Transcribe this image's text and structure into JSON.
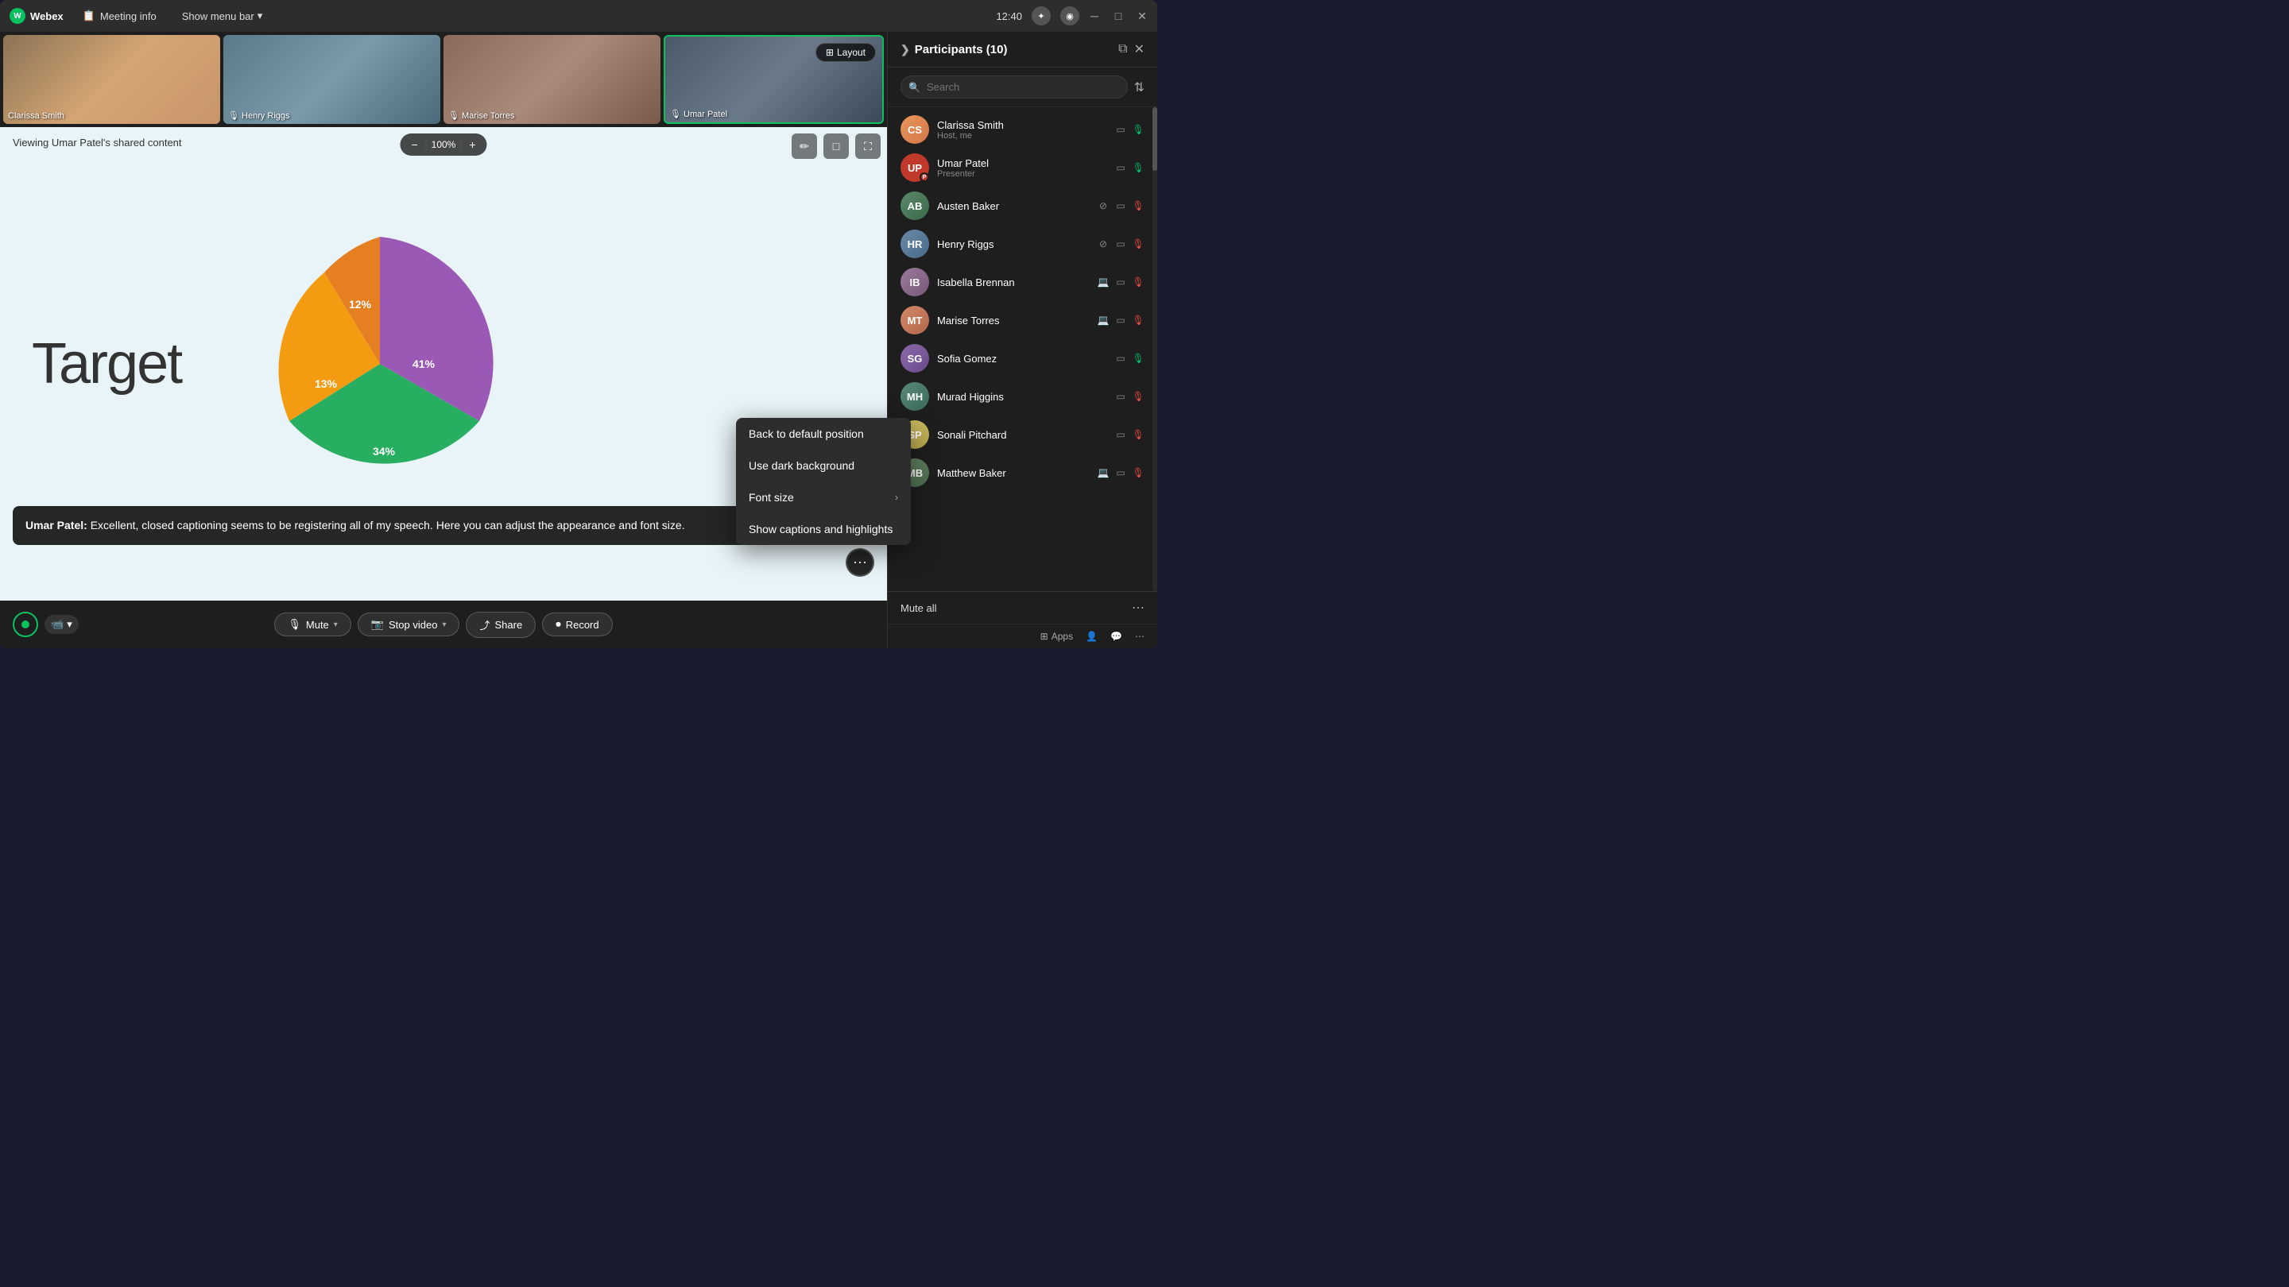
{
  "titlebar": {
    "app_name": "Webex",
    "meeting_info_label": "Meeting info",
    "show_menu_label": "Show menu bar",
    "time": "12:40"
  },
  "thumbnails": [
    {
      "name": "Clarissa Smith",
      "style": "thumb-clarissa",
      "has_mic": false
    },
    {
      "name": "Henry Riggs",
      "style": "thumb-henry",
      "has_mic": true
    },
    {
      "name": "Marise Torres",
      "style": "thumb-marise",
      "has_mic": true
    },
    {
      "name": "Umar Patel",
      "style": "thumb-umar",
      "active": true,
      "has_mic": true
    }
  ],
  "layout_btn": "Layout",
  "shared_content": {
    "viewing_label": "Viewing Umar Patel's shared content",
    "zoom": "100%",
    "chart_title": "Target",
    "pie_data": [
      {
        "label": "41%",
        "color": "#9b59b6",
        "angle_start": 0,
        "angle_end": 147.6
      },
      {
        "label": "34%",
        "color": "#27ae60",
        "angle_start": 147.6,
        "angle_end": 270
      },
      {
        "label": "13%",
        "color": "#f39c12",
        "angle_start": 270,
        "angle_end": 316.8
      },
      {
        "label": "12%",
        "color": "#e67e22",
        "angle_start": 316.8,
        "angle_end": 360
      }
    ]
  },
  "caption": {
    "speaker": "Umar Patel",
    "text": "Excellent, closed captioning seems to be registering all of my speech. Here you can adjust the appearance and font size."
  },
  "toolbar": {
    "mute_label": "Mute",
    "stop_video_label": "Stop video",
    "share_label": "Share",
    "record_label": "Record"
  },
  "participants_panel": {
    "title": "Participants",
    "count": 10,
    "search_placeholder": "Search",
    "mute_all_label": "Mute all",
    "participants": [
      {
        "name": "Clarissa Smith",
        "role": "Host, me",
        "avatar": "CS",
        "av_class": "av-clarissa",
        "video": true,
        "mic": true,
        "mic_red": false
      },
      {
        "name": "Umar Patel",
        "role": "Presenter",
        "avatar": "UP",
        "av_class": "av-umar",
        "video": true,
        "mic": true,
        "mic_red": false
      },
      {
        "name": "Austen Baker",
        "role": "",
        "avatar": "AB",
        "av_class": "av-austen",
        "video": true,
        "mic": false,
        "mic_red": true
      },
      {
        "name": "Henry Riggs",
        "role": "",
        "avatar": "HR",
        "av_class": "av-henry",
        "video": true,
        "mic": false,
        "mic_red": true
      },
      {
        "name": "Isabella Brennan",
        "role": "",
        "avatar": "IB",
        "av_class": "av-isabella",
        "video": true,
        "mic": false,
        "mic_red": true
      },
      {
        "name": "Marise Torres",
        "role": "",
        "avatar": "MT",
        "av_class": "av-marise",
        "video": true,
        "mic": false,
        "mic_red": true
      },
      {
        "name": "Sofia Gomez",
        "role": "",
        "avatar": "SG",
        "av_class": "av-sofia",
        "video": true,
        "mic": true,
        "mic_red": false
      },
      {
        "name": "Murad Higgins",
        "role": "",
        "avatar": "MH",
        "av_class": "av-murad",
        "video": true,
        "mic": false,
        "mic_red": true
      },
      {
        "name": "Sonali Pitchard",
        "role": "",
        "avatar": "SP",
        "av_class": "av-sonali",
        "video": true,
        "mic": false,
        "mic_red": true
      },
      {
        "name": "Matthew Baker",
        "role": "",
        "avatar": "MB",
        "av_class": "av-matthew",
        "video": true,
        "mic": false,
        "mic_red": true
      }
    ]
  },
  "context_menu": {
    "items": [
      {
        "label": "Back to default position",
        "has_arrow": false
      },
      {
        "label": "Use dark background",
        "has_arrow": false
      },
      {
        "label": "Font size",
        "has_arrow": true
      },
      {
        "label": "Show captions and highlights",
        "has_arrow": false
      }
    ]
  },
  "footer_icons": [
    {
      "name": "Apps",
      "icon": "⊞"
    },
    {
      "name": "people-icon",
      "icon": "👤"
    },
    {
      "name": "chat-icon",
      "icon": "💬"
    },
    {
      "name": "more-icon",
      "icon": "⋯"
    }
  ]
}
